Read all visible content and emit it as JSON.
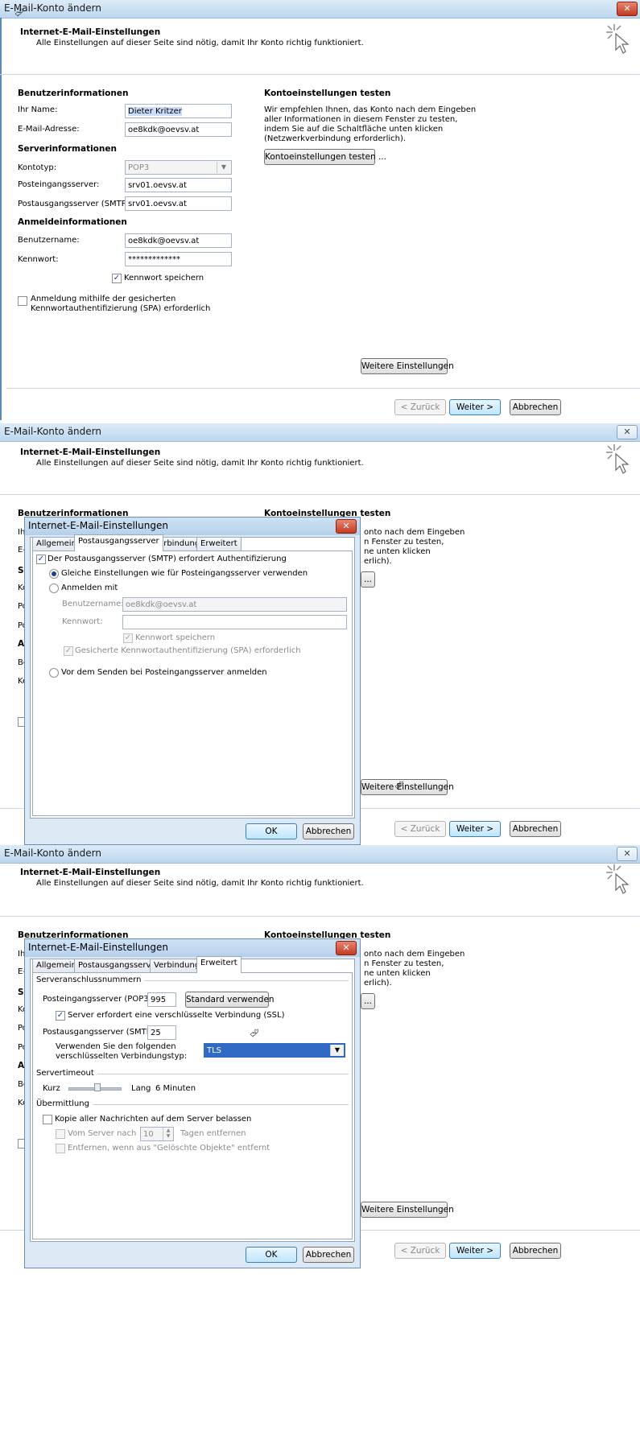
{
  "window": {
    "title": "E-Mail-Konto ändern",
    "close": "✕"
  },
  "header": {
    "title": "Internet-E-Mail-Einstellungen",
    "subtitle": "Alle Einstellungen auf dieser Seite sind nötig, damit Ihr Konto richtig funktioniert."
  },
  "user_info": {
    "section": "Benutzerinformationen",
    "name_label": "Ihr Name:",
    "name_value": "Dieter Kritzer",
    "email_label": "E-Mail-Adresse:",
    "email_value": "oe8kdk@oevsv.at"
  },
  "server_info": {
    "section": "Serverinformationen",
    "type_label": "Kontotyp:",
    "type_value": "POP3",
    "incoming_label": "Posteingangsserver:",
    "incoming_value": "srv01.oevsv.at",
    "outgoing_label": "Postausgangsserver (SMTP):",
    "outgoing_value": "srv01.oevsv.at"
  },
  "login_info": {
    "section": "Anmeldeinformationen",
    "user_label": "Benutzername:",
    "user_value": "oe8kdk@oevsv.at",
    "password_label": "Kennwort:",
    "password_value": "*************",
    "remember_label": "Kennwort speichern",
    "spa_label_1": "Anmeldung mithilfe der gesicherten",
    "spa_label_2": "Kennwortauthentifizierung (SPA) erforderlich"
  },
  "test": {
    "section": "Kontoeinstellungen testen",
    "line1": "Wir empfehlen Ihnen, das Konto nach dem Eingeben",
    "line2": "aller Informationen in diesem Fenster zu testen,",
    "line3": "indem Sie auf die Schaltfläche unten klicken",
    "line4": "(Netzwerkverbindung erforderlich).",
    "button": "Kontoeinstellungen testen ...",
    "cut_line1": "onto nach dem Eingeben",
    "cut_line2": "n Fenster zu testen,",
    "cut_line3": "ne unten klicken",
    "cut_line4": "erlich).",
    "cut_button": "..."
  },
  "buttons": {
    "more": "Weitere Einstellungen",
    "more_cut": "Weitere Einstellungen",
    "back": "< Zurück",
    "next": "Weiter >",
    "cancel": "Abbrechen"
  },
  "cut_labels": {
    "name": "Ihr",
    "email": "E-M",
    "server": "Se",
    "type": "Ko",
    "incoming": "Po",
    "outgoing": "Po",
    "login": "An",
    "user": "Be",
    "password": "Ke"
  },
  "dialog": {
    "title": "Internet-E-Mail-Einstellungen",
    "tabs": [
      "Allgemein",
      "Postausgangsserver",
      "Verbindung",
      "Erweitert"
    ],
    "ok": "OK",
    "cancel": "Abbrechen"
  },
  "outgoing_tab": {
    "requires_auth": "Der Postausgangsserver (SMTP) erfordert Authentifizierung",
    "same_settings": "Gleiche Einstellungen wie für Posteingangsserver verwenden",
    "login_with": "Anmelden mit",
    "user_label": "Benutzername:",
    "user_value": "oe8kdk@oevsv.at",
    "password_label": "Kennwort:",
    "password_value": "",
    "remember": "Kennwort speichern",
    "spa": "Gesicherte Kennwortauthentifizierung (SPA) erforderlich",
    "before_send": "Vor dem Senden bei Posteingangsserver anmelden"
  },
  "advanced_tab": {
    "ports_group": "Serveranschlussnummern",
    "incoming_label": "Posteingangsserver (POP3):",
    "incoming_port": "995",
    "default_button": "Standard verwenden",
    "ssl_label": "Server erfordert eine verschlüsselte Verbindung (SSL)",
    "outgoing_label": "Postausgangsserver (SMTP):",
    "outgoing_port": "25",
    "enc_label_1": "Verwenden Sie den folgenden",
    "enc_label_2": "verschlüsselten Verbindungstyp:",
    "enc_value": "TLS",
    "timeout_group": "Servertimeout",
    "short": "Kurz",
    "long": "Lang",
    "timeout_value": "6 Minuten",
    "delivery_group": "Übermittlung",
    "leave_copy": "Kopie aller Nachrichten auf dem Server belassen",
    "remove_after": "Vom Server nach",
    "days_value": "10",
    "days_suffix": "Tagen entfernen",
    "remove_deleted": "Entfernen, wenn aus \"Gelöschte Objekte\" entfernt"
  },
  "colors": {
    "accent": "#3c7fb1",
    "selection": "#316ac5",
    "close_red": "#c23b21"
  }
}
